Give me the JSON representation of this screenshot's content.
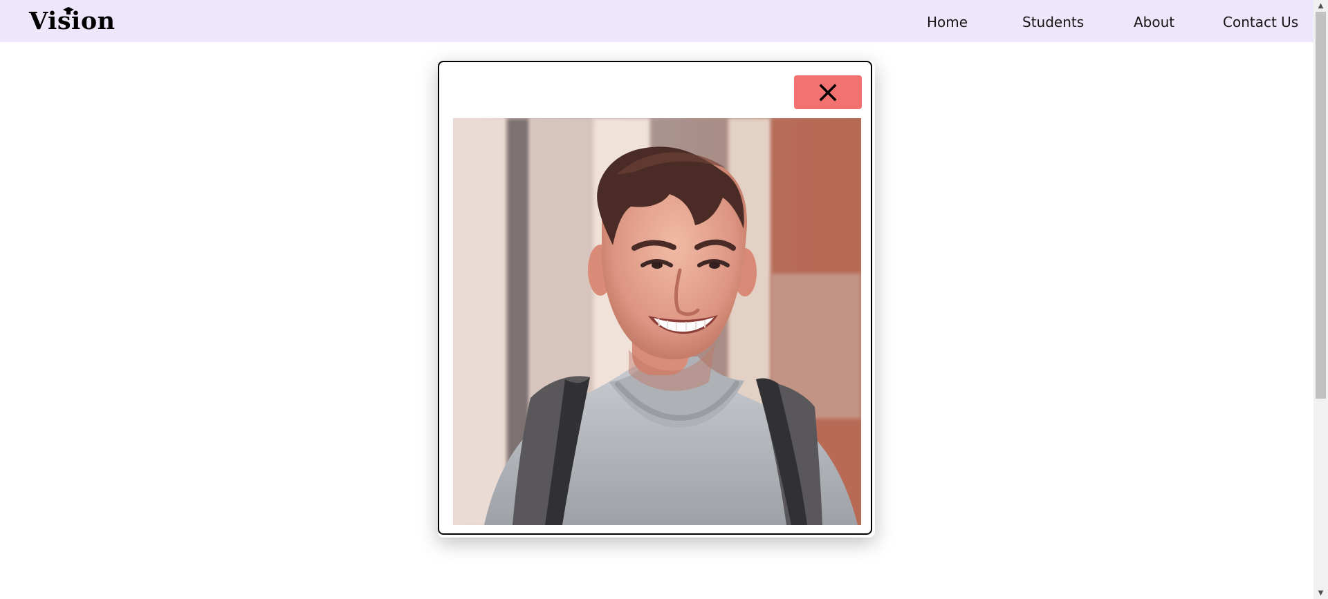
{
  "brand": {
    "name": "Vision",
    "logo_icon": "graduation-cap-icon"
  },
  "nav": {
    "items": [
      {
        "label": "Home"
      },
      {
        "label": "Students"
      },
      {
        "label": "About"
      },
      {
        "label": "Contact Us"
      }
    ]
  },
  "modal": {
    "close_icon": "close-icon",
    "image_alt": "Smiling student with backpack",
    "close_button_color": "#f27272"
  },
  "colors": {
    "navbar": "#eee7fb",
    "background": "#ffffff",
    "accent": "#f27272"
  }
}
